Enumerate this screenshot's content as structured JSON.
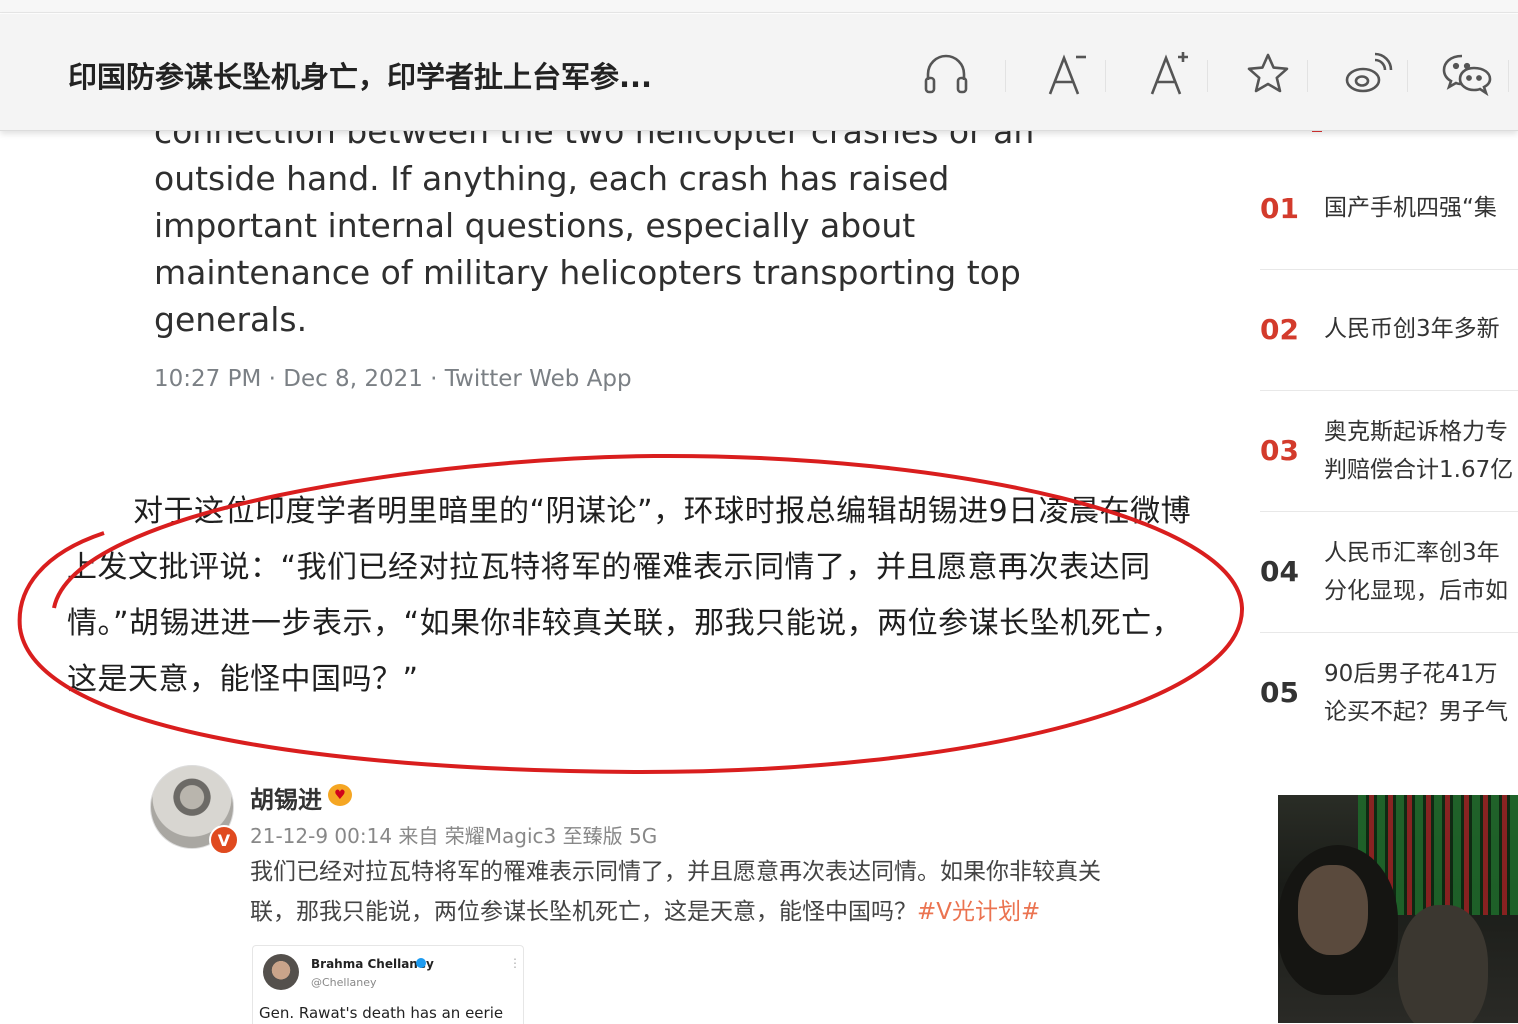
{
  "header": {
    "title": "印国防参谋长坠机身亡，印学者扯上台军参...",
    "tools": [
      {
        "name": "listen",
        "icon": "headphones-icon"
      },
      {
        "name": "font_smaller",
        "icon": "font-decrease-icon"
      },
      {
        "name": "font_larger",
        "icon": "font-increase-icon"
      },
      {
        "name": "favorite",
        "icon": "star-icon"
      },
      {
        "name": "weibo_share",
        "icon": "weibo-icon"
      },
      {
        "name": "wechat_share",
        "icon": "wechat-icon"
      }
    ]
  },
  "article": {
    "tweet_text": "connection between the two helicopter crashes or an outside hand. If anything, each crash has raised important internal questions, especially about maintenance of military helicopters transporting top generals.",
    "tweet_meta": "10:27 PM · Dec 8, 2021 · Twitter Web App",
    "paragraph": "对于这位印度学者明里暗里的“阴谋论”，环球时报总编辑胡锡进9日凌晨在微博上发文批评说：“我们已经对拉瓦特将军的罹难表示同情了，并且愿意再次表达同情。”胡锡进进一步表示，“如果你非较真关联，那我只能说，两位参谋长坠机死亡，这是天意，能怪中国吗？”",
    "highlight_color": "#d91e1e"
  },
  "weibo": {
    "user": "胡锡进",
    "verified_mark": "V",
    "meta": "21-12-9 00:14 来自 荣耀Magic3 至臻版 5G",
    "text": "我们已经对拉瓦特将军的罹难表示同情了，并且愿意再次表达同情。如果你非较真关联，那我只能说，两位参谋长坠机死亡，这是天意，能怪中国吗？",
    "tag": "#V光计划#",
    "embed": {
      "name": "Brahma Chellaney",
      "handle": "@Chellaney",
      "text": "Gen. Rawat's death has an eerie"
    }
  },
  "sidebar": {
    "accent": "#d33b2c",
    "items": [
      {
        "num": "01",
        "title": "国产手机四强“集"
      },
      {
        "num": "02",
        "title": "人民币创3年多新"
      },
      {
        "num": "03",
        "title": "奥克斯起诉格力专",
        "title2": "判赔偿合计1.67亿"
      },
      {
        "num": "04",
        "title": "人民币汇率创3年",
        "title2": "分化显现，后市如"
      },
      {
        "num": "05",
        "title": "90后男子花41万",
        "title2": "论买不起？男子气"
      }
    ]
  }
}
